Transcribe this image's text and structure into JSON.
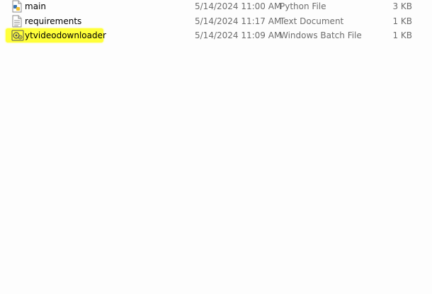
{
  "files": [
    {
      "name": "main",
      "date_modified": "5/14/2024 11:00 AM",
      "type": "Python File",
      "size": "3 KB",
      "icon": "python-file-icon"
    },
    {
      "name": "requirements",
      "date_modified": "5/14/2024 11:17 AM",
      "type": "Text Document",
      "size": "1 KB",
      "icon": "text-file-icon"
    },
    {
      "name": "ytvideodownloader",
      "date_modified": "5/14/2024 11:09 AM",
      "type": "Windows Batch File",
      "size": "1 KB",
      "icon": "batch-file-icon",
      "highlight_color": "#ffff3a"
    }
  ]
}
